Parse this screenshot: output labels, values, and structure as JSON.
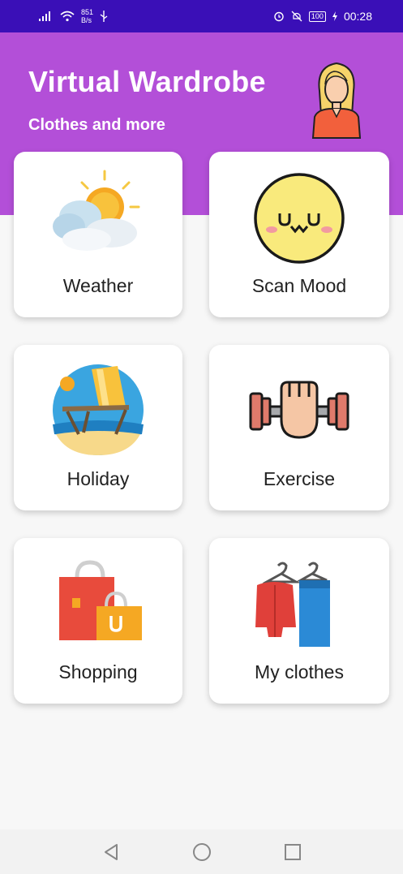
{
  "status_bar": {
    "net_speed_value": "851",
    "net_speed_unit": "B/s",
    "battery": "100",
    "time": "00:28"
  },
  "header": {
    "title": "Virtual Wardrobe",
    "subtitle": "Clothes and more"
  },
  "colors": {
    "status_bar": "#3a0fb7",
    "header": "#b34fd8",
    "card": "#ffffff",
    "background": "#f7f7f7"
  },
  "tiles": [
    {
      "label": "Weather",
      "icon": "weather-icon"
    },
    {
      "label": "Scan Mood",
      "icon": "mood-face-icon"
    },
    {
      "label": "Holiday",
      "icon": "beach-chair-icon"
    },
    {
      "label": "Exercise",
      "icon": "dumbbell-fist-icon"
    },
    {
      "label": "Shopping",
      "icon": "shopping-bags-icon"
    },
    {
      "label": "My clothes",
      "icon": "clothes-hanger-icon"
    }
  ],
  "nav": {
    "back": "back-icon",
    "home": "home-icon",
    "recents": "recents-icon"
  }
}
